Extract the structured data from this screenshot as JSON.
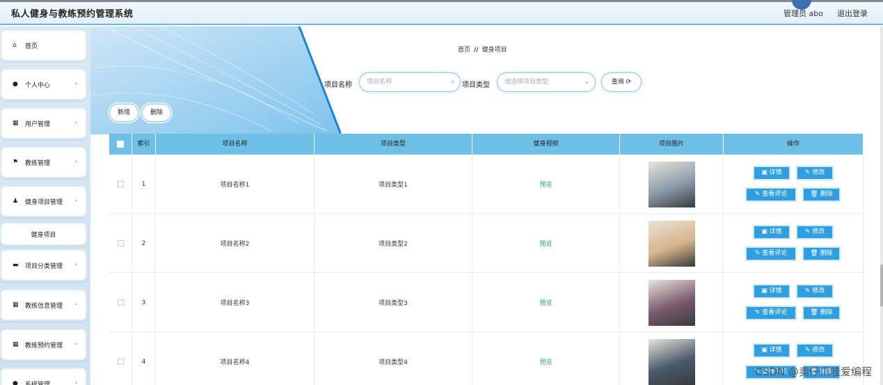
{
  "header": {
    "title": "私人健身与教练预约管理系统",
    "user": "管理员 abo",
    "logout": "退出登录"
  },
  "sidebar": {
    "items": [
      {
        "label": "首页",
        "icon": "home-icon",
        "glyph": "⌂",
        "arrow": false
      },
      {
        "label": "个人中心",
        "icon": "person-icon",
        "glyph": "●",
        "arrow": true
      },
      {
        "label": "用户管理",
        "icon": "grid-icon",
        "glyph": "▦",
        "arrow": true
      },
      {
        "label": "教练管理",
        "icon": "flag-icon",
        "glyph": "⚑",
        "arrow": true
      },
      {
        "label": "健身项目管理",
        "icon": "user-group-icon",
        "glyph": "♟",
        "arrow": true
      },
      {
        "label": "健身项目",
        "icon": "",
        "glyph": "",
        "arrow": false,
        "sub": true
      },
      {
        "label": "项目分类管理",
        "icon": "monitor-icon",
        "glyph": "▬",
        "arrow": true
      },
      {
        "label": "教练信息管理",
        "icon": "grid-icon",
        "glyph": "▦",
        "arrow": true
      },
      {
        "label": "教练预约管理",
        "icon": "grid-icon",
        "glyph": "▦",
        "arrow": true
      },
      {
        "label": "系统管理",
        "icon": "person-icon",
        "glyph": "●",
        "arrow": true
      }
    ]
  },
  "breadcrumb": {
    "home": "首页",
    "sep": "//",
    "current": "健身项目"
  },
  "search": {
    "name_label": "项目名称",
    "name_placeholder": "项目名称",
    "type_label": "项目类型",
    "type_placeholder": "请选择项目类型",
    "query_label": "查询 ⟳"
  },
  "actions": {
    "add": "新增",
    "delete": "删除"
  },
  "table": {
    "headers": [
      "",
      "索引",
      "项目名称",
      "项目类型",
      "健身视频",
      "项目图片",
      "操作"
    ],
    "rows": [
      {
        "index": "1",
        "name": "项目名称1",
        "type": "项目类型1",
        "video": "预览",
        "image_color": "#8a9aa8"
      },
      {
        "index": "2",
        "name": "项目名称2",
        "type": "项目类型2",
        "video": "预览",
        "image_color": "#d6b48c"
      },
      {
        "index": "3",
        "name": "项目名称3",
        "type": "项目类型3",
        "video": "预览",
        "image_color": "#7a5a6e"
      },
      {
        "index": "4",
        "name": "项目名称4",
        "type": "项目类型4",
        "video": "预览",
        "image_color": "#4a5a6a"
      }
    ],
    "ops": {
      "detail": "▣ 详情",
      "edit": "✎ 修改",
      "review": "✎ 查看评论",
      "remove": "🗑 删除"
    }
  },
  "watermark": "CSDN @卖仔爪哇爱编程"
}
